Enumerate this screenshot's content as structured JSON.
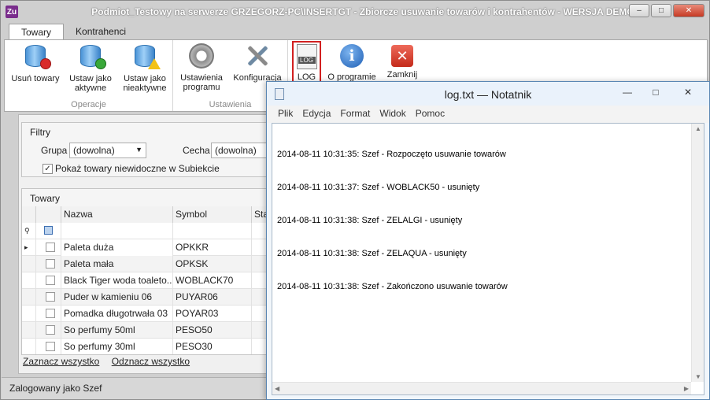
{
  "window": {
    "title": "Podmiot_Testowy na serwerze GRZEGORZ-PC\\INSERTGT - Zbiorcze usuwanie towarów i kontrahentów - WERSJA DEMO",
    "app_icon": "Zu",
    "minimize": "–",
    "maximize": "□",
    "close": "✕"
  },
  "tabs": [
    "Towary",
    "Kontrahenci"
  ],
  "ribbon": {
    "operacje": {
      "label": "Operacje",
      "usun": "Usuń towary",
      "aktywne_1": "Ustaw jako",
      "aktywne_2": "aktywne",
      "nieaktywne_1": "Ustaw jako",
      "nieaktywne_2": "nieaktywne"
    },
    "ustawienia": {
      "label": "Ustawienia",
      "program_1": "Ustawienia",
      "program_2": "programu",
      "konfiguracja": "Konfiguracja"
    },
    "log": "LOG",
    "log_tag": "LOG",
    "o_programie": "O programie",
    "zamknij": "Zamknij",
    "info_glyph": "i",
    "close_glyph": "✕"
  },
  "filtry": {
    "title": "Filtry",
    "grupa_label": "Grupa",
    "grupa_value": "(dowolna)",
    "cecha_label": "Cecha",
    "cecha_value": "(dowolna)",
    "show_hidden_label": "Pokaż towary niewidoczne w Subiekcie",
    "show_hidden_checked": "✓"
  },
  "towary": {
    "title": "Towary",
    "columns": [
      "Nazwa",
      "Symbol",
      "Sta"
    ],
    "filter_row_icon": "⚲",
    "rows": [
      {
        "nazwa": "Paleta duża",
        "symbol": "OPKKR"
      },
      {
        "nazwa": "Paleta mała",
        "symbol": "OPKSK"
      },
      {
        "nazwa": "Black Tiger woda toaleto...",
        "symbol": "WOBLACK70"
      },
      {
        "nazwa": "Puder w kamieniu 06",
        "symbol": "PUYAR06"
      },
      {
        "nazwa": "Pomadka długotrwała 03",
        "symbol": "POYAR03"
      },
      {
        "nazwa": "So perfumy 50ml",
        "symbol": "PESO50"
      },
      {
        "nazwa": "So perfumy 30ml",
        "symbol": "PESO30"
      }
    ],
    "current_row_marker": "▸"
  },
  "links": {
    "select_all": "Zaznacz wszystko",
    "deselect_all": "Odznacz wszystko"
  },
  "status": "Zalogowany jako Szef",
  "notepad": {
    "title": "log.txt — Notatnik",
    "minimize": "—",
    "maximize": "□",
    "close": "✕",
    "menu": [
      "Plik",
      "Edycja",
      "Format",
      "Widok",
      "Pomoc"
    ],
    "lines": [
      "2014-08-11 10:31:35: Szef - Rozpoczęto usuwanie towarów",
      "2014-08-11 10:31:37: Szef - WOBLACK50 - usunięty",
      "2014-08-11 10:31:38: Szef - ZELALGI - usunięty",
      "2014-08-11 10:31:38: Szef - ZELAQUA - usunięty",
      "2014-08-11 10:31:38: Szef - Zakończono usuwanie towarów"
    ]
  }
}
